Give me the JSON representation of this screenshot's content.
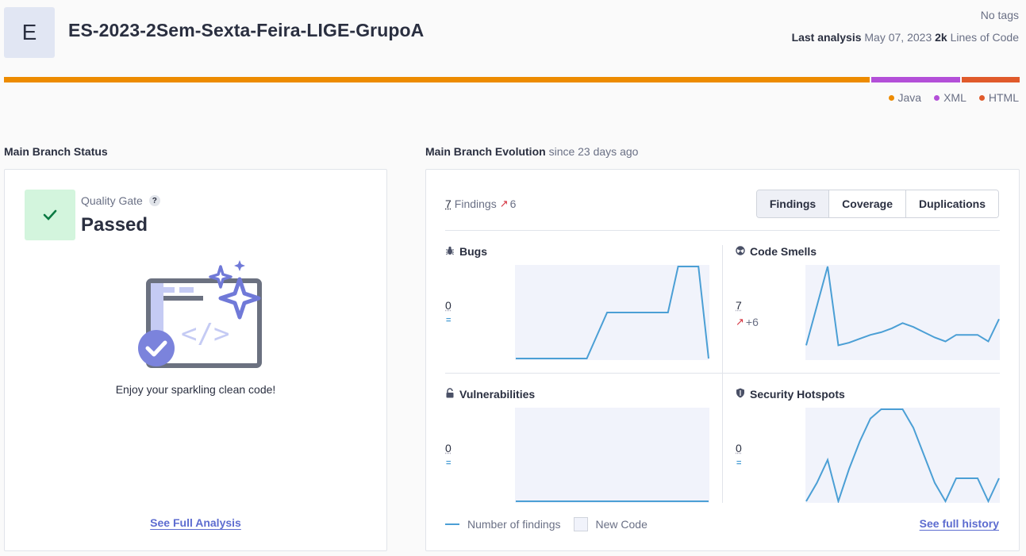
{
  "project": {
    "avatar_letter": "E",
    "title": "ES-2023-2Sem-Sexta-Feira-LIGE-GrupoA",
    "tags": "No tags",
    "last_analysis_label": "Last analysis",
    "last_analysis_date": "May 07, 2023",
    "loc_value": "2k",
    "loc_label": "Lines of Code"
  },
  "languages": [
    {
      "name": "Java",
      "color": "#ed8b00",
      "share": 0.855
    },
    {
      "name": "XML",
      "color": "#b34fd8",
      "share": 0.088
    },
    {
      "name": "HTML",
      "color": "#e05a2b",
      "share": 0.057
    }
  ],
  "status": {
    "section_title": "Main Branch Status",
    "quality_gate_label": "Quality Gate",
    "help": "?",
    "quality_gate_status": "Passed",
    "message": "Enjoy your sparkling clean code!",
    "link": "See Full Analysis"
  },
  "evolution": {
    "section_title": "Main Branch Evolution",
    "since": "since 23 days ago",
    "findings_count": "7",
    "findings_label": "Findings",
    "findings_delta": "6",
    "tabs": [
      "Findings",
      "Coverage",
      "Duplications"
    ],
    "metrics": [
      {
        "title": "Bugs",
        "icon": "bug-icon",
        "value": "0",
        "delta": "",
        "series": [
          0,
          0,
          0,
          0,
          0,
          0,
          0,
          0,
          0.25,
          0.5,
          0.5,
          0.5,
          0.5,
          0.5,
          0.5,
          0.5,
          1,
          1,
          1,
          0
        ],
        "bar_ticks": []
      },
      {
        "title": "Code Smells",
        "icon": "code-smell-icon",
        "value": "7",
        "delta": "+6",
        "series": [
          1,
          4,
          7,
          1,
          1.2,
          1.5,
          1.8,
          2,
          2.3,
          2.7,
          2.4,
          2,
          1.6,
          1.3,
          1.8,
          1.8,
          1.8,
          1.3,
          3
        ],
        "bar_ticks": []
      },
      {
        "title": "Vulnerabilities",
        "icon": "lock-icon",
        "value": "0",
        "delta": "",
        "series": [
          0,
          0,
          0,
          0,
          0,
          0,
          0,
          0,
          0,
          0,
          0,
          0,
          0,
          0,
          0,
          0,
          0,
          0,
          0,
          0
        ],
        "bar_ticks": []
      },
      {
        "title": "Security Hotspots",
        "icon": "shield-icon",
        "value": "0",
        "delta": "",
        "series": [
          0,
          0.4,
          0.9,
          0,
          0.7,
          1.3,
          1.8,
          2,
          2,
          2,
          1.6,
          1,
          0.4,
          0,
          0.5,
          0.5,
          0.5,
          0,
          0.5
        ],
        "bar_ticks": []
      }
    ],
    "legend_line": "Number of findings",
    "legend_new_code": "New Code",
    "history_link": "See full history"
  }
}
